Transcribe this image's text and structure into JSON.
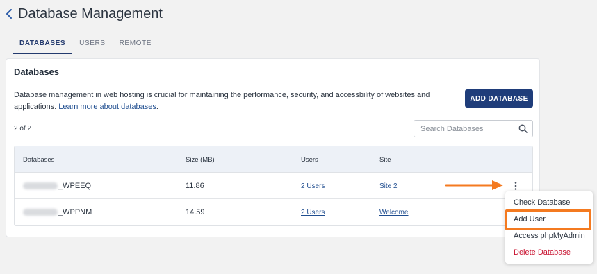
{
  "header": {
    "title": "Database Management"
  },
  "tabs": [
    {
      "label": "DATABASES",
      "active": true
    },
    {
      "label": "USERS",
      "active": false
    },
    {
      "label": "REMOTE",
      "active": false
    }
  ],
  "card": {
    "title": "Databases",
    "description": "Database management in web hosting is crucial for maintaining the performance, security, and accessbility of websites and applications.",
    "learn_more": "Learn more about databases",
    "description_end": ".",
    "add_button": "ADD DATABASE",
    "count": "2 of 2",
    "search_placeholder": "Search Databases"
  },
  "table": {
    "columns": [
      "Databases",
      "Size (MB)",
      "Users",
      "Site"
    ],
    "rows": [
      {
        "name": "_WPEEQ",
        "size": "11.86",
        "users": "2 Users",
        "site": "Site 2"
      },
      {
        "name": "_WPPNM",
        "size": "14.59",
        "users": "2 Users",
        "site": "Welcome"
      }
    ]
  },
  "menu": {
    "items": [
      "Check Database",
      "Add User",
      "Access phpMyAdmin",
      "Delete Database"
    ]
  },
  "colors": {
    "primary": "#1f3d7a",
    "link": "#1f4d8f",
    "danger": "#c8102e",
    "annotation": "#f47a20"
  }
}
